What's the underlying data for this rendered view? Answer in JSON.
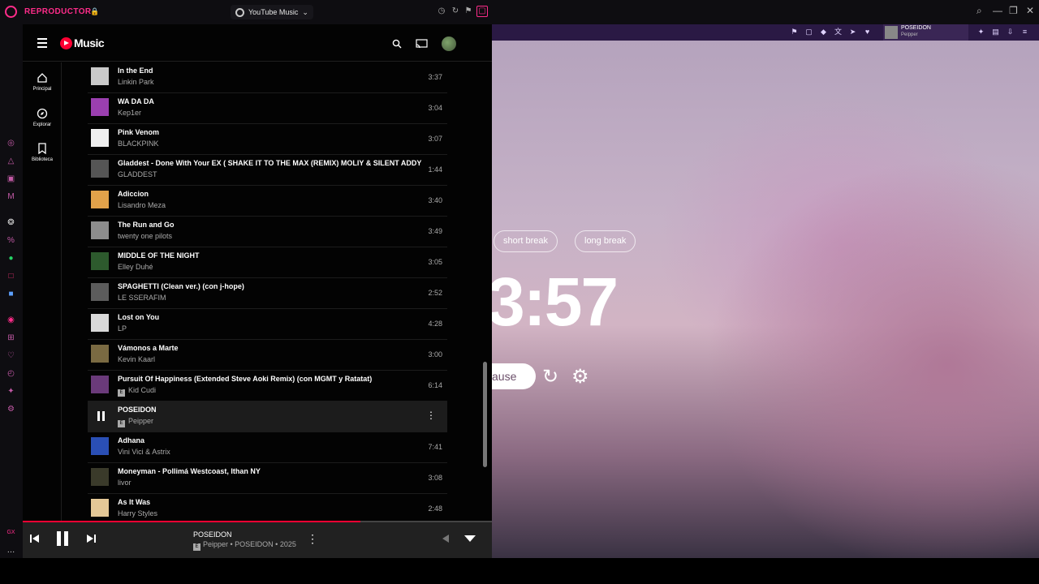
{
  "window": {
    "app_title": "REPRODUCTOR",
    "tab_label": "YouTube Music"
  },
  "ytmusic": {
    "logo_text": "Music",
    "nav": [
      {
        "label": "Principal",
        "icon": "home-icon"
      },
      {
        "label": "Explorar",
        "icon": "compass-icon"
      },
      {
        "label": "Biblioteca",
        "icon": "bookmark-icon"
      }
    ],
    "tracks": [
      {
        "title": "In the End",
        "artist": "Linkin Park",
        "duration": "3:37",
        "explicit": false,
        "thumb": "#c9c9c9"
      },
      {
        "title": "WA DA DA",
        "artist": "Kep1er",
        "duration": "3:04",
        "explicit": false,
        "thumb": "#9b3fb0"
      },
      {
        "title": "Pink Venom",
        "artist": "BLACKPINK",
        "duration": "3:07",
        "explicit": false,
        "thumb": "#efefef"
      },
      {
        "title": "Gladdest - Done With Your EX ( SHAKE IT TO THE MAX (REMIX) MOLIY & SILENT ADDY",
        "artist": "GLADDEST",
        "duration": "1:44",
        "explicit": false,
        "thumb": "#555"
      },
      {
        "title": "Adiccion",
        "artist": "Lisandro Meza",
        "duration": "3:40",
        "explicit": false,
        "thumb": "#e2a24a"
      },
      {
        "title": "The Run and Go",
        "artist": "twenty one pilots",
        "duration": "3:49",
        "explicit": false,
        "thumb": "#8d8d8d"
      },
      {
        "title": "MIDDLE OF THE NIGHT",
        "artist": "Elley Duhé",
        "duration": "3:05",
        "explicit": false,
        "thumb": "#2d5a2d"
      },
      {
        "title": "SPAGHETTI (Clean ver.) (con j-hope)",
        "artist": "LE SSERAFIM",
        "duration": "2:52",
        "explicit": false,
        "thumb": "#5c5c5c"
      },
      {
        "title": "Lost on You",
        "artist": "LP",
        "duration": "4:28",
        "explicit": false,
        "thumb": "#d8d8d8"
      },
      {
        "title": "Vámonos a Marte",
        "artist": "Kevin Kaarl",
        "duration": "3:00",
        "explicit": false,
        "thumb": "#7a6a42"
      },
      {
        "title": "Pursuit Of Happiness (Extended Steve Aoki Remix) (con MGMT y Ratatat)",
        "artist": "Kid Cudi",
        "duration": "6:14",
        "explicit": true,
        "thumb": "#6a3a7a"
      },
      {
        "title": "POSEIDON",
        "artist": "Peipper",
        "duration": "",
        "explicit": true,
        "thumb": "#1c1c1c",
        "playing": true
      },
      {
        "title": "Adhana",
        "artist": "Vini Vici & Astrix",
        "duration": "7:41",
        "explicit": false,
        "thumb": "#2a4fb5"
      },
      {
        "title": "Moneyman - Pollimá Westcoast, Ithan NY",
        "artist": "livor",
        "duration": "3:08",
        "explicit": false,
        "thumb": "#3a3a2a"
      },
      {
        "title": "As It Was",
        "artist": "Harry Styles",
        "duration": "2:48",
        "explicit": false,
        "thumb": "#e4c897"
      }
    ],
    "player": {
      "title": "POSEIDON",
      "subtitle": "Peipper • POSEIDON • 2025",
      "progress_fraction": 0.72
    }
  },
  "right_panel": {
    "mini_song": {
      "title": "POSEIDON",
      "artist": "Peipper"
    },
    "short_break_label": "short break",
    "long_break_label": "long break",
    "clock": "3:57",
    "pause_label": "ause"
  },
  "colors": {
    "accent": "#ff2c8a",
    "yt_red": "#ff0033"
  }
}
